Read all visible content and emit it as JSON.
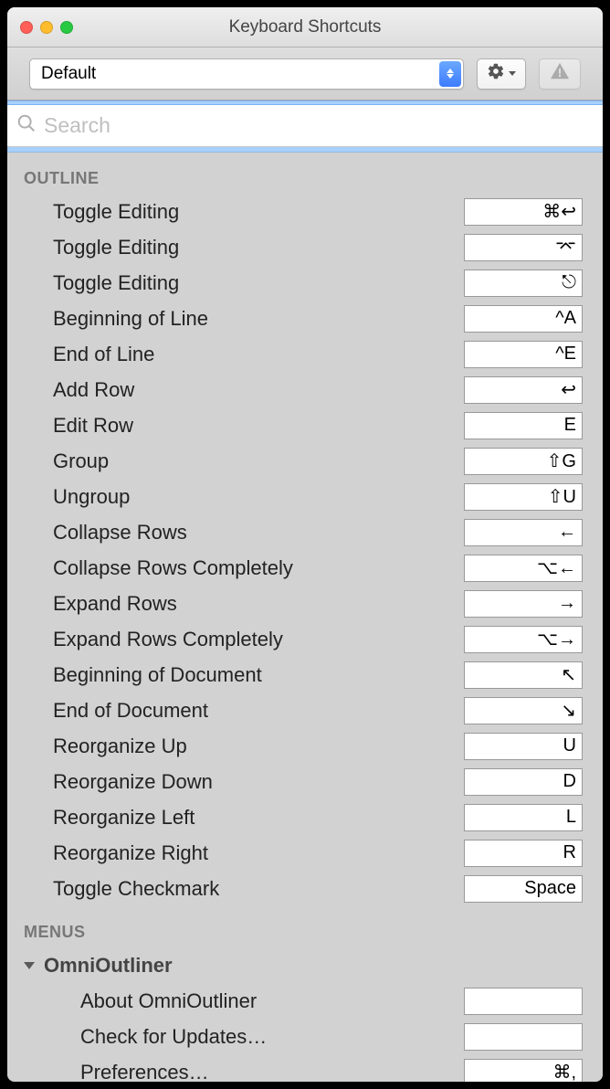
{
  "window": {
    "title": "Keyboard Shortcuts"
  },
  "toolbar": {
    "preset": "Default"
  },
  "search": {
    "placeholder": "Search",
    "value": ""
  },
  "sections": [
    {
      "id": "outline",
      "header": "OUTLINE",
      "rows": [
        {
          "label": "Toggle Editing",
          "shortcut": "⌘↩"
        },
        {
          "label": "Toggle Editing",
          "shortcut": "⌤"
        },
        {
          "label": "Toggle Editing",
          "shortcut": "⎋"
        },
        {
          "label": "Beginning of Line",
          "shortcut": "^A"
        },
        {
          "label": "End of Line",
          "shortcut": "^E"
        },
        {
          "label": "Add Row",
          "shortcut": "↩"
        },
        {
          "label": "Edit Row",
          "shortcut": "E"
        },
        {
          "label": "Group",
          "shortcut": "⇧G"
        },
        {
          "label": "Ungroup",
          "shortcut": "⇧U"
        },
        {
          "label": "Collapse Rows",
          "shortcut": "←"
        },
        {
          "label": "Collapse Rows Completely",
          "shortcut": "⌥←"
        },
        {
          "label": "Expand Rows",
          "shortcut": "→"
        },
        {
          "label": "Expand Rows Completely",
          "shortcut": "⌥→"
        },
        {
          "label": "Beginning of Document",
          "shortcut": "↖"
        },
        {
          "label": "End of Document",
          "shortcut": "↘"
        },
        {
          "label": "Reorganize Up",
          "shortcut": "U"
        },
        {
          "label": "Reorganize Down",
          "shortcut": "D"
        },
        {
          "label": "Reorganize Left",
          "shortcut": "L"
        },
        {
          "label": "Reorganize Right",
          "shortcut": "R"
        },
        {
          "label": "Toggle Checkmark",
          "shortcut": "Space"
        }
      ]
    }
  ],
  "menus": {
    "header": "MENUS",
    "groups": [
      {
        "title": "OmniOutliner",
        "expanded": true,
        "items": [
          {
            "label": "About OmniOutliner",
            "shortcut": ""
          },
          {
            "label": "Check for Updates…",
            "shortcut": ""
          },
          {
            "label": "Preferences…",
            "shortcut": "⌘,"
          }
        ]
      }
    ]
  }
}
